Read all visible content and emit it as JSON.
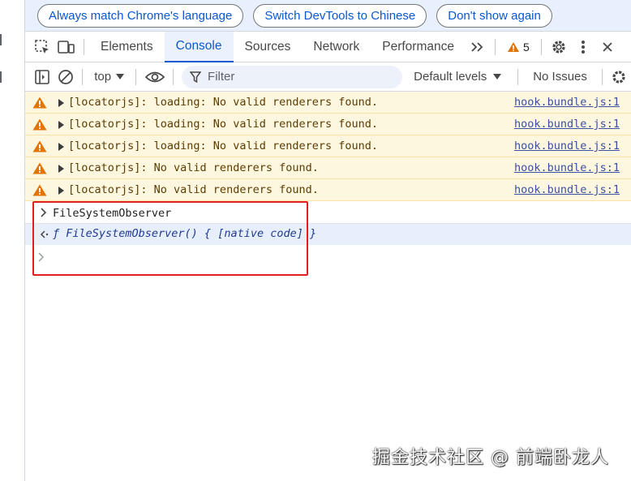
{
  "infobar": {
    "buttons": [
      "Always match Chrome's language",
      "Switch DevTools to Chinese",
      "Don't show again"
    ]
  },
  "tabs": {
    "items": [
      "Elements",
      "Console",
      "Sources",
      "Network",
      "Performance"
    ],
    "active": "Console",
    "more_icon": "double-chevron-right-icon",
    "warning_count": "5"
  },
  "console_toolbar": {
    "context": "top",
    "filter_placeholder": "Filter",
    "levels": "Default levels",
    "issues": "No Issues"
  },
  "messages": [
    {
      "text": "[locatorjs]: loading: No valid renderers found.",
      "source": "hook.bundle.js:1"
    },
    {
      "text": "[locatorjs]: loading: No valid renderers found.",
      "source": "hook.bundle.js:1"
    },
    {
      "text": "[locatorjs]: loading: No valid renderers found.",
      "source": "hook.bundle.js:1"
    },
    {
      "text": "[locatorjs]: No valid renderers found.",
      "source": "hook.bundle.js:1"
    },
    {
      "text": "[locatorjs]: No valid renderers found.",
      "source": "hook.bundle.js:1"
    }
  ],
  "input": {
    "command": "FileSystemObserver",
    "result": "ƒ FileSystemObserver() { [native code] }"
  },
  "watermark": "掘金技术社区 @ 前端卧龙人",
  "colors": {
    "accent": "#0b57d0",
    "warning_bg": "#fef7e0",
    "warning_icon": "#e37400",
    "highlight": "#e02020"
  }
}
